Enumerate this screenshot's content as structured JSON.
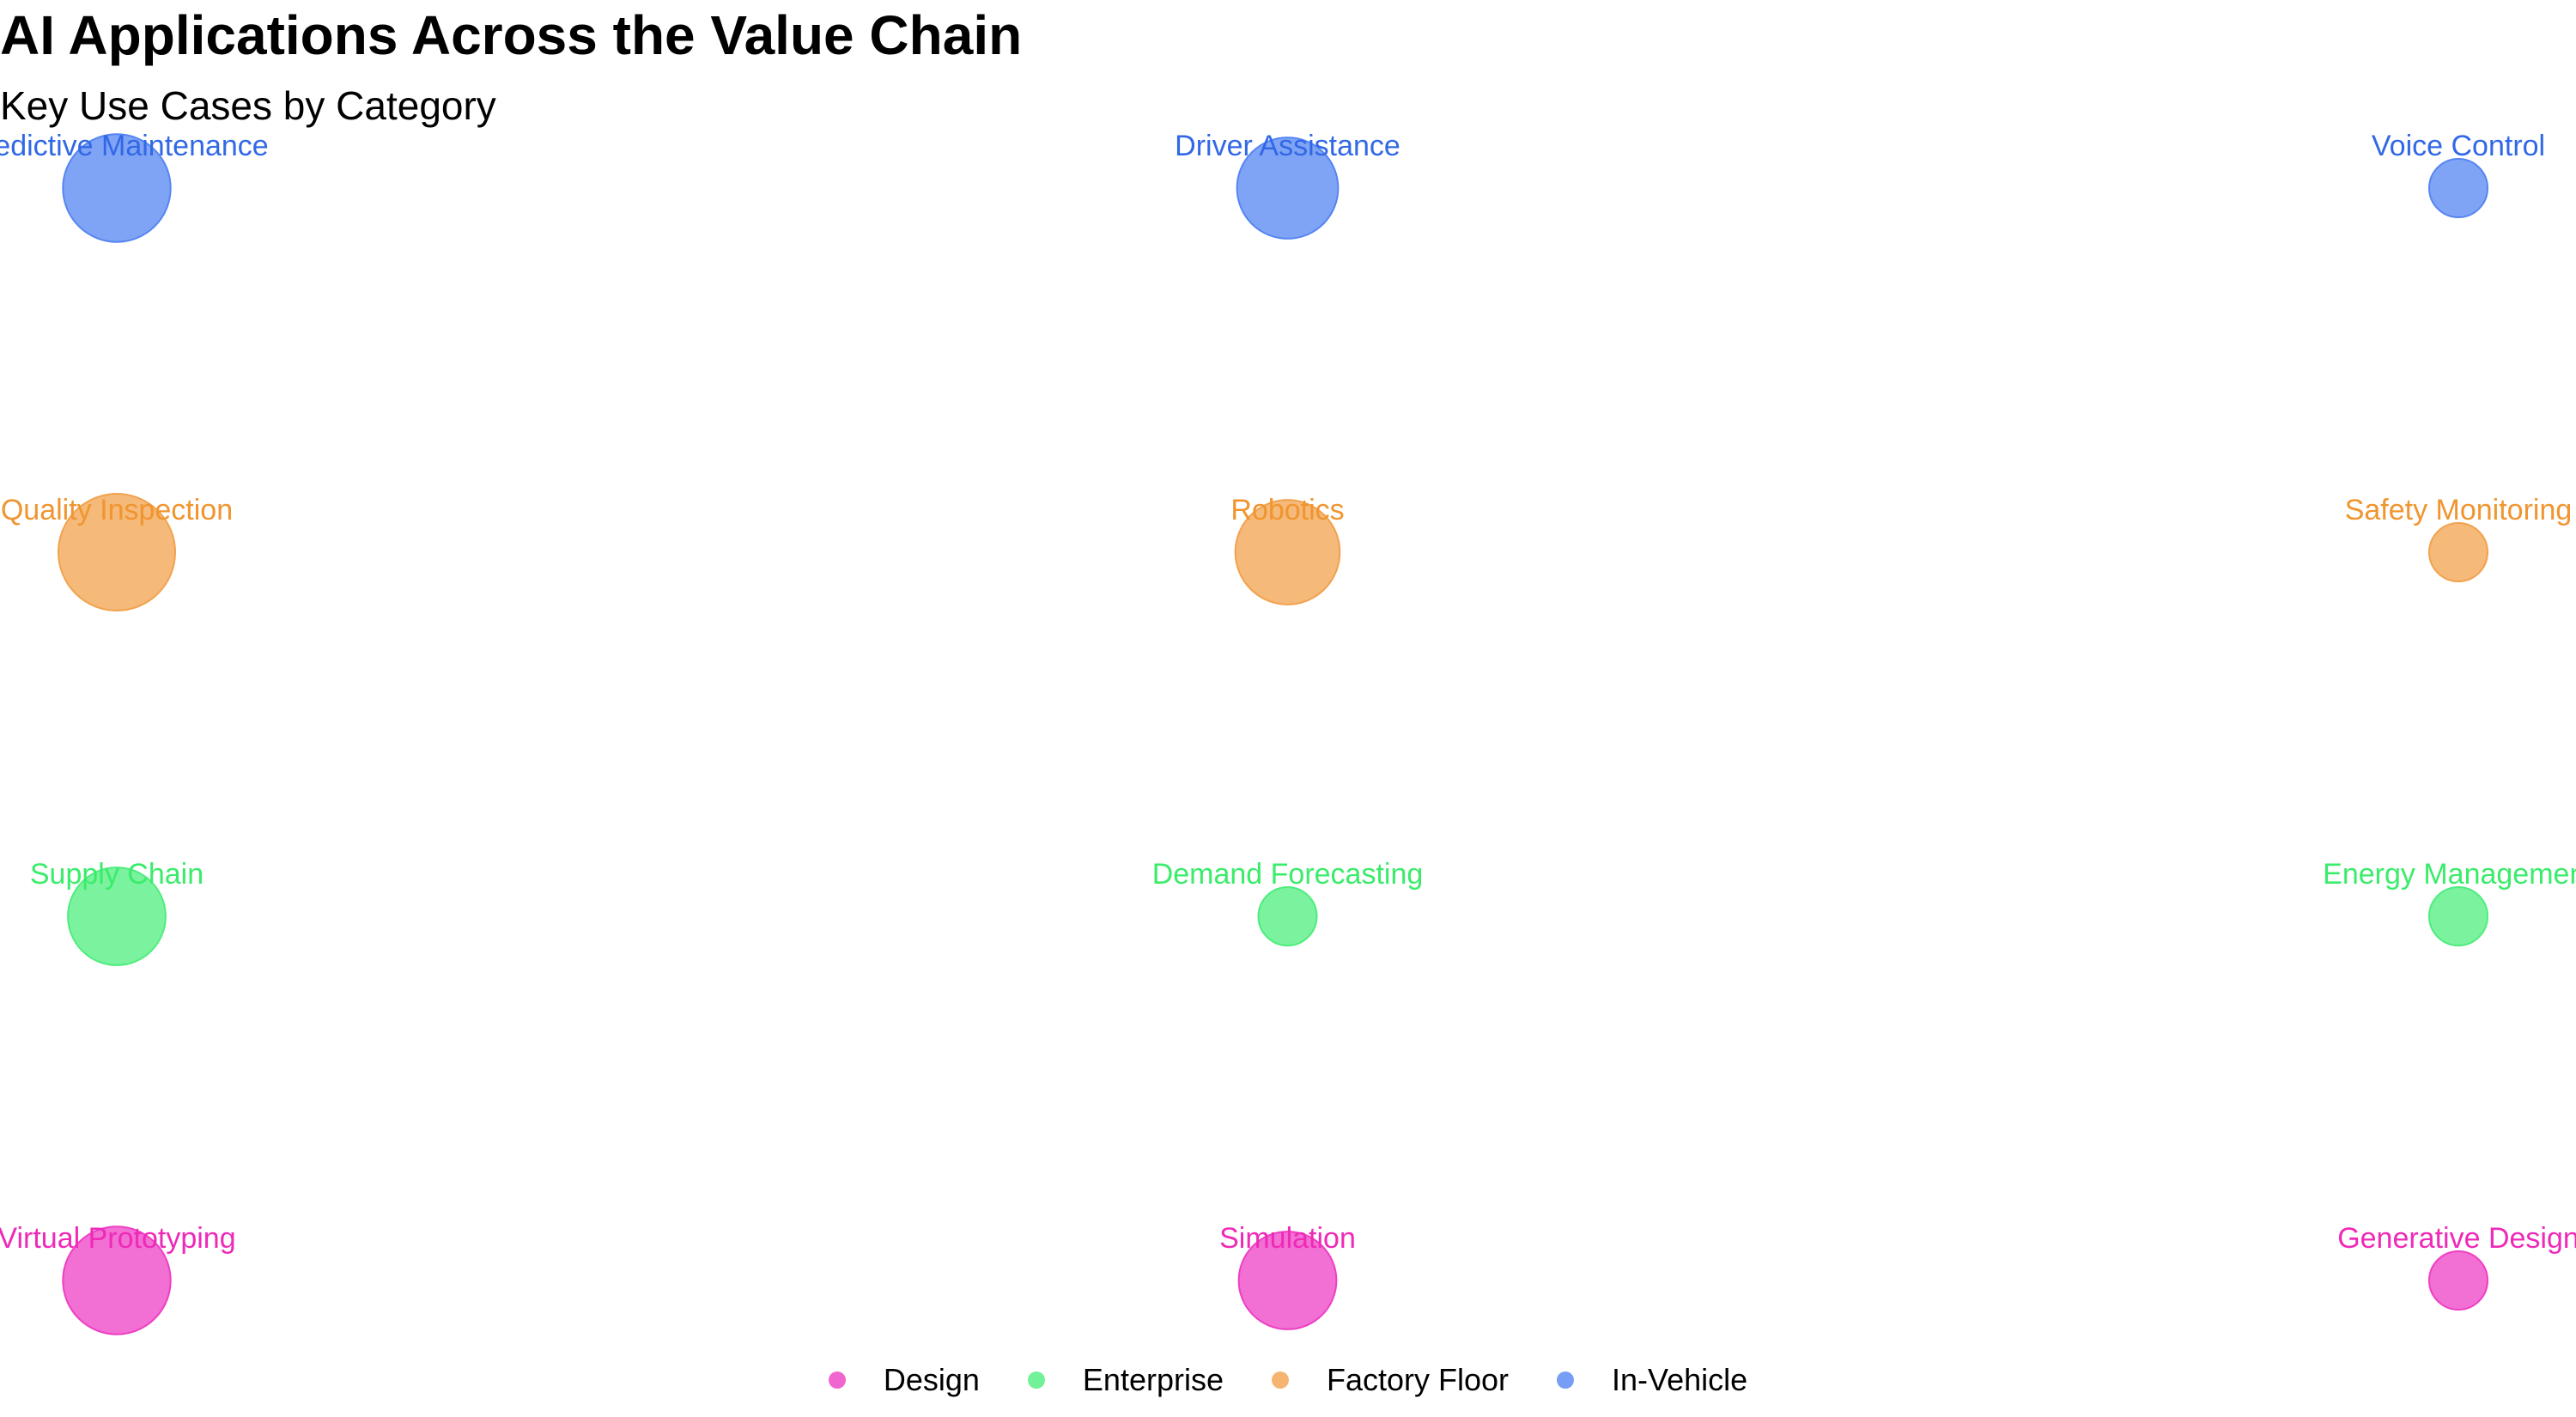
{
  "title": "AI Applications Across the Value Chain",
  "subtitle": "Key Use Cases by Category",
  "colors": {
    "Design": "#ee3fc4",
    "Enterprise": "#4eed7e",
    "Factory Floor": "#f2a24d",
    "In-Vehicle": "#5585f2"
  },
  "label_colors": {
    "Design": "#ee2ab8",
    "Enterprise": "#3bec6b",
    "Factory Floor": "#f0952f",
    "In-Vehicle": "#3168e6"
  },
  "legend": [
    {
      "label": "Design"
    },
    {
      "label": "Enterprise"
    },
    {
      "label": "Factory Floor"
    },
    {
      "label": "In-Vehicle"
    }
  ],
  "chart_data": {
    "type": "scatter",
    "title": "AI Applications Across the Value Chain",
    "subtitle": "Key Use Cases by Category",
    "categories": [
      "Design",
      "Enterprise",
      "Factory Floor",
      "In-Vehicle"
    ],
    "xlim": [
      1,
      3
    ],
    "grid": false,
    "legend_position": "bottom",
    "points": [
      {
        "label": "Virtual Prototyping",
        "category": "Design",
        "x": 1,
        "size": 85
      },
      {
        "label": "Simulation",
        "category": "Design",
        "x": 2,
        "size": 70
      },
      {
        "label": "Generative Design",
        "category": "Design",
        "x": 3,
        "size": 25
      },
      {
        "label": "Supply Chain",
        "category": "Enterprise",
        "x": 1,
        "size": 70
      },
      {
        "label": "Demand Forecasting",
        "category": "Enterprise",
        "x": 2,
        "size": 25
      },
      {
        "label": "Energy Management",
        "category": "Enterprise",
        "x": 3,
        "size": 25
      },
      {
        "label": "Quality Inspection",
        "category": "Factory Floor",
        "x": 1,
        "size": 100
      },
      {
        "label": "Robotics",
        "category": "Factory Floor",
        "x": 2,
        "size": 80
      },
      {
        "label": "Safety Monitoring",
        "category": "Factory Floor",
        "x": 3,
        "size": 25
      },
      {
        "label": "Predictive Maintenance",
        "category": "In-Vehicle",
        "x": 1,
        "size": 85
      },
      {
        "label": "Driver Assistance",
        "category": "In-Vehicle",
        "x": 2,
        "size": 75
      },
      {
        "label": "Voice Control",
        "category": "In-Vehicle",
        "x": 3,
        "size": 25
      }
    ]
  }
}
